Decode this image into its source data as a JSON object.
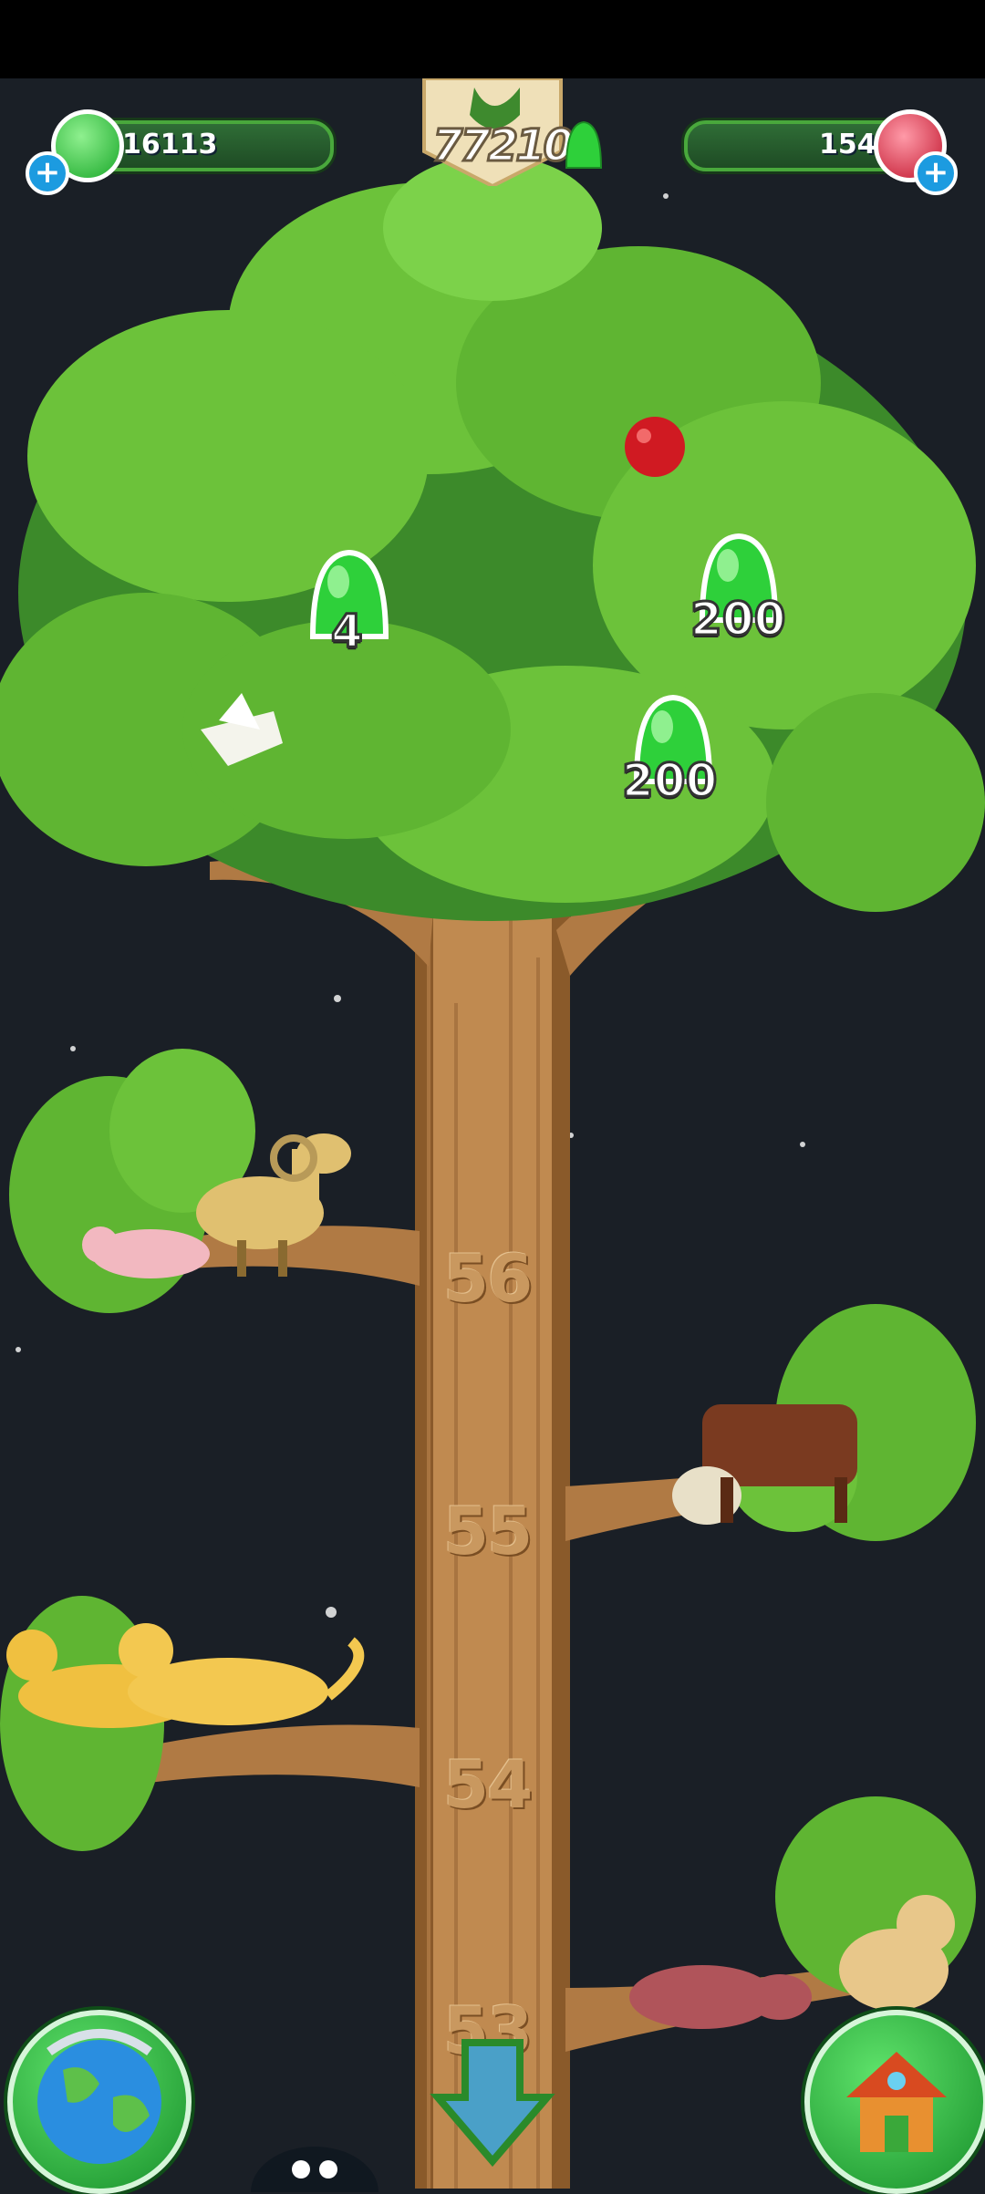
{
  "status_bar": {},
  "hud": {
    "jelly_count": "16113",
    "score": "77210",
    "gem_count": "154",
    "add_symbol": "+"
  },
  "tree": {
    "levels": [
      "56",
      "55",
      "54",
      "53"
    ]
  },
  "collectibles": [
    {
      "label": "4"
    },
    {
      "label": "200"
    },
    {
      "label": "200"
    }
  ],
  "animals": [
    "mole-rat",
    "camel-ram",
    "bull",
    "cheetah",
    "cheetah",
    "aardvark",
    "lynx"
  ],
  "buttons": {
    "globe": "globe-icon",
    "scroll_down": "down-arrow-icon",
    "house": "house-icon"
  },
  "colors": {
    "leaf": "#6cc23a",
    "leaf_dark": "#3c8a2a",
    "trunk": "#c08a50",
    "trunk_dark": "#8a5a2a",
    "jelly": "#2ed03a",
    "sky": "#1a1f26"
  }
}
